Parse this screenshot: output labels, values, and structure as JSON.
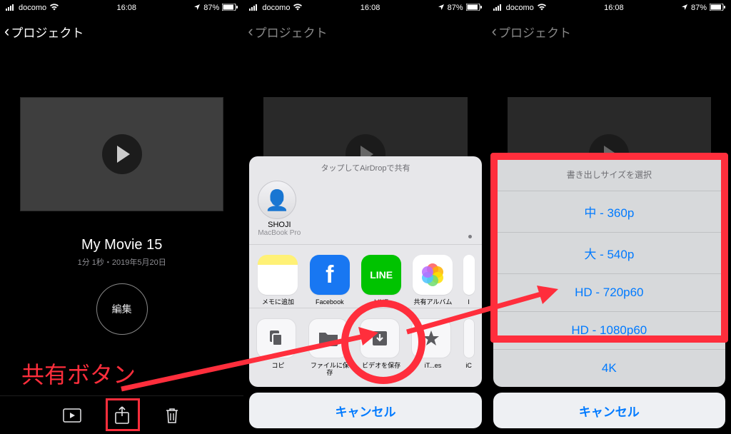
{
  "status": {
    "carrier": "docomo",
    "time": "16:08",
    "battery": "87%"
  },
  "nav": {
    "back_label": "プロジェクト"
  },
  "panel1": {
    "movie_title": "My Movie 15",
    "movie_meta": "1分 1秒・2019年5月20日",
    "edit_label": "編集",
    "annotation": "共有ボタン"
  },
  "share_sheet": {
    "airdrop_hint": "タップしてAirDropで共有",
    "airdrop_contact": {
      "name": "SHOJI",
      "device": "MacBook Pro"
    },
    "apps": [
      {
        "label": "メモに追加",
        "kind": "notes"
      },
      {
        "label": "Facebook",
        "kind": "facebook"
      },
      {
        "label": "LINE",
        "kind": "line"
      },
      {
        "label": "共有アルバム",
        "kind": "photos"
      },
      {
        "label": "I",
        "kind": "more"
      }
    ],
    "actions": [
      {
        "label": "コピ",
        "kind": "copy"
      },
      {
        "label": "ファイルに保存",
        "kind": "files"
      },
      {
        "label": "ビデオを保存",
        "kind": "save-video"
      },
      {
        "label": "iT...es",
        "kind": "itunes"
      },
      {
        "label": "iC",
        "kind": "more"
      }
    ],
    "cancel": "キャンセル"
  },
  "export_sheet": {
    "title": "書き出しサイズを選択",
    "options": [
      "中 - 360p",
      "大 - 540p",
      "HD - 720p60",
      "HD - 1080p60",
      "4K"
    ],
    "cancel": "キャンセル"
  }
}
